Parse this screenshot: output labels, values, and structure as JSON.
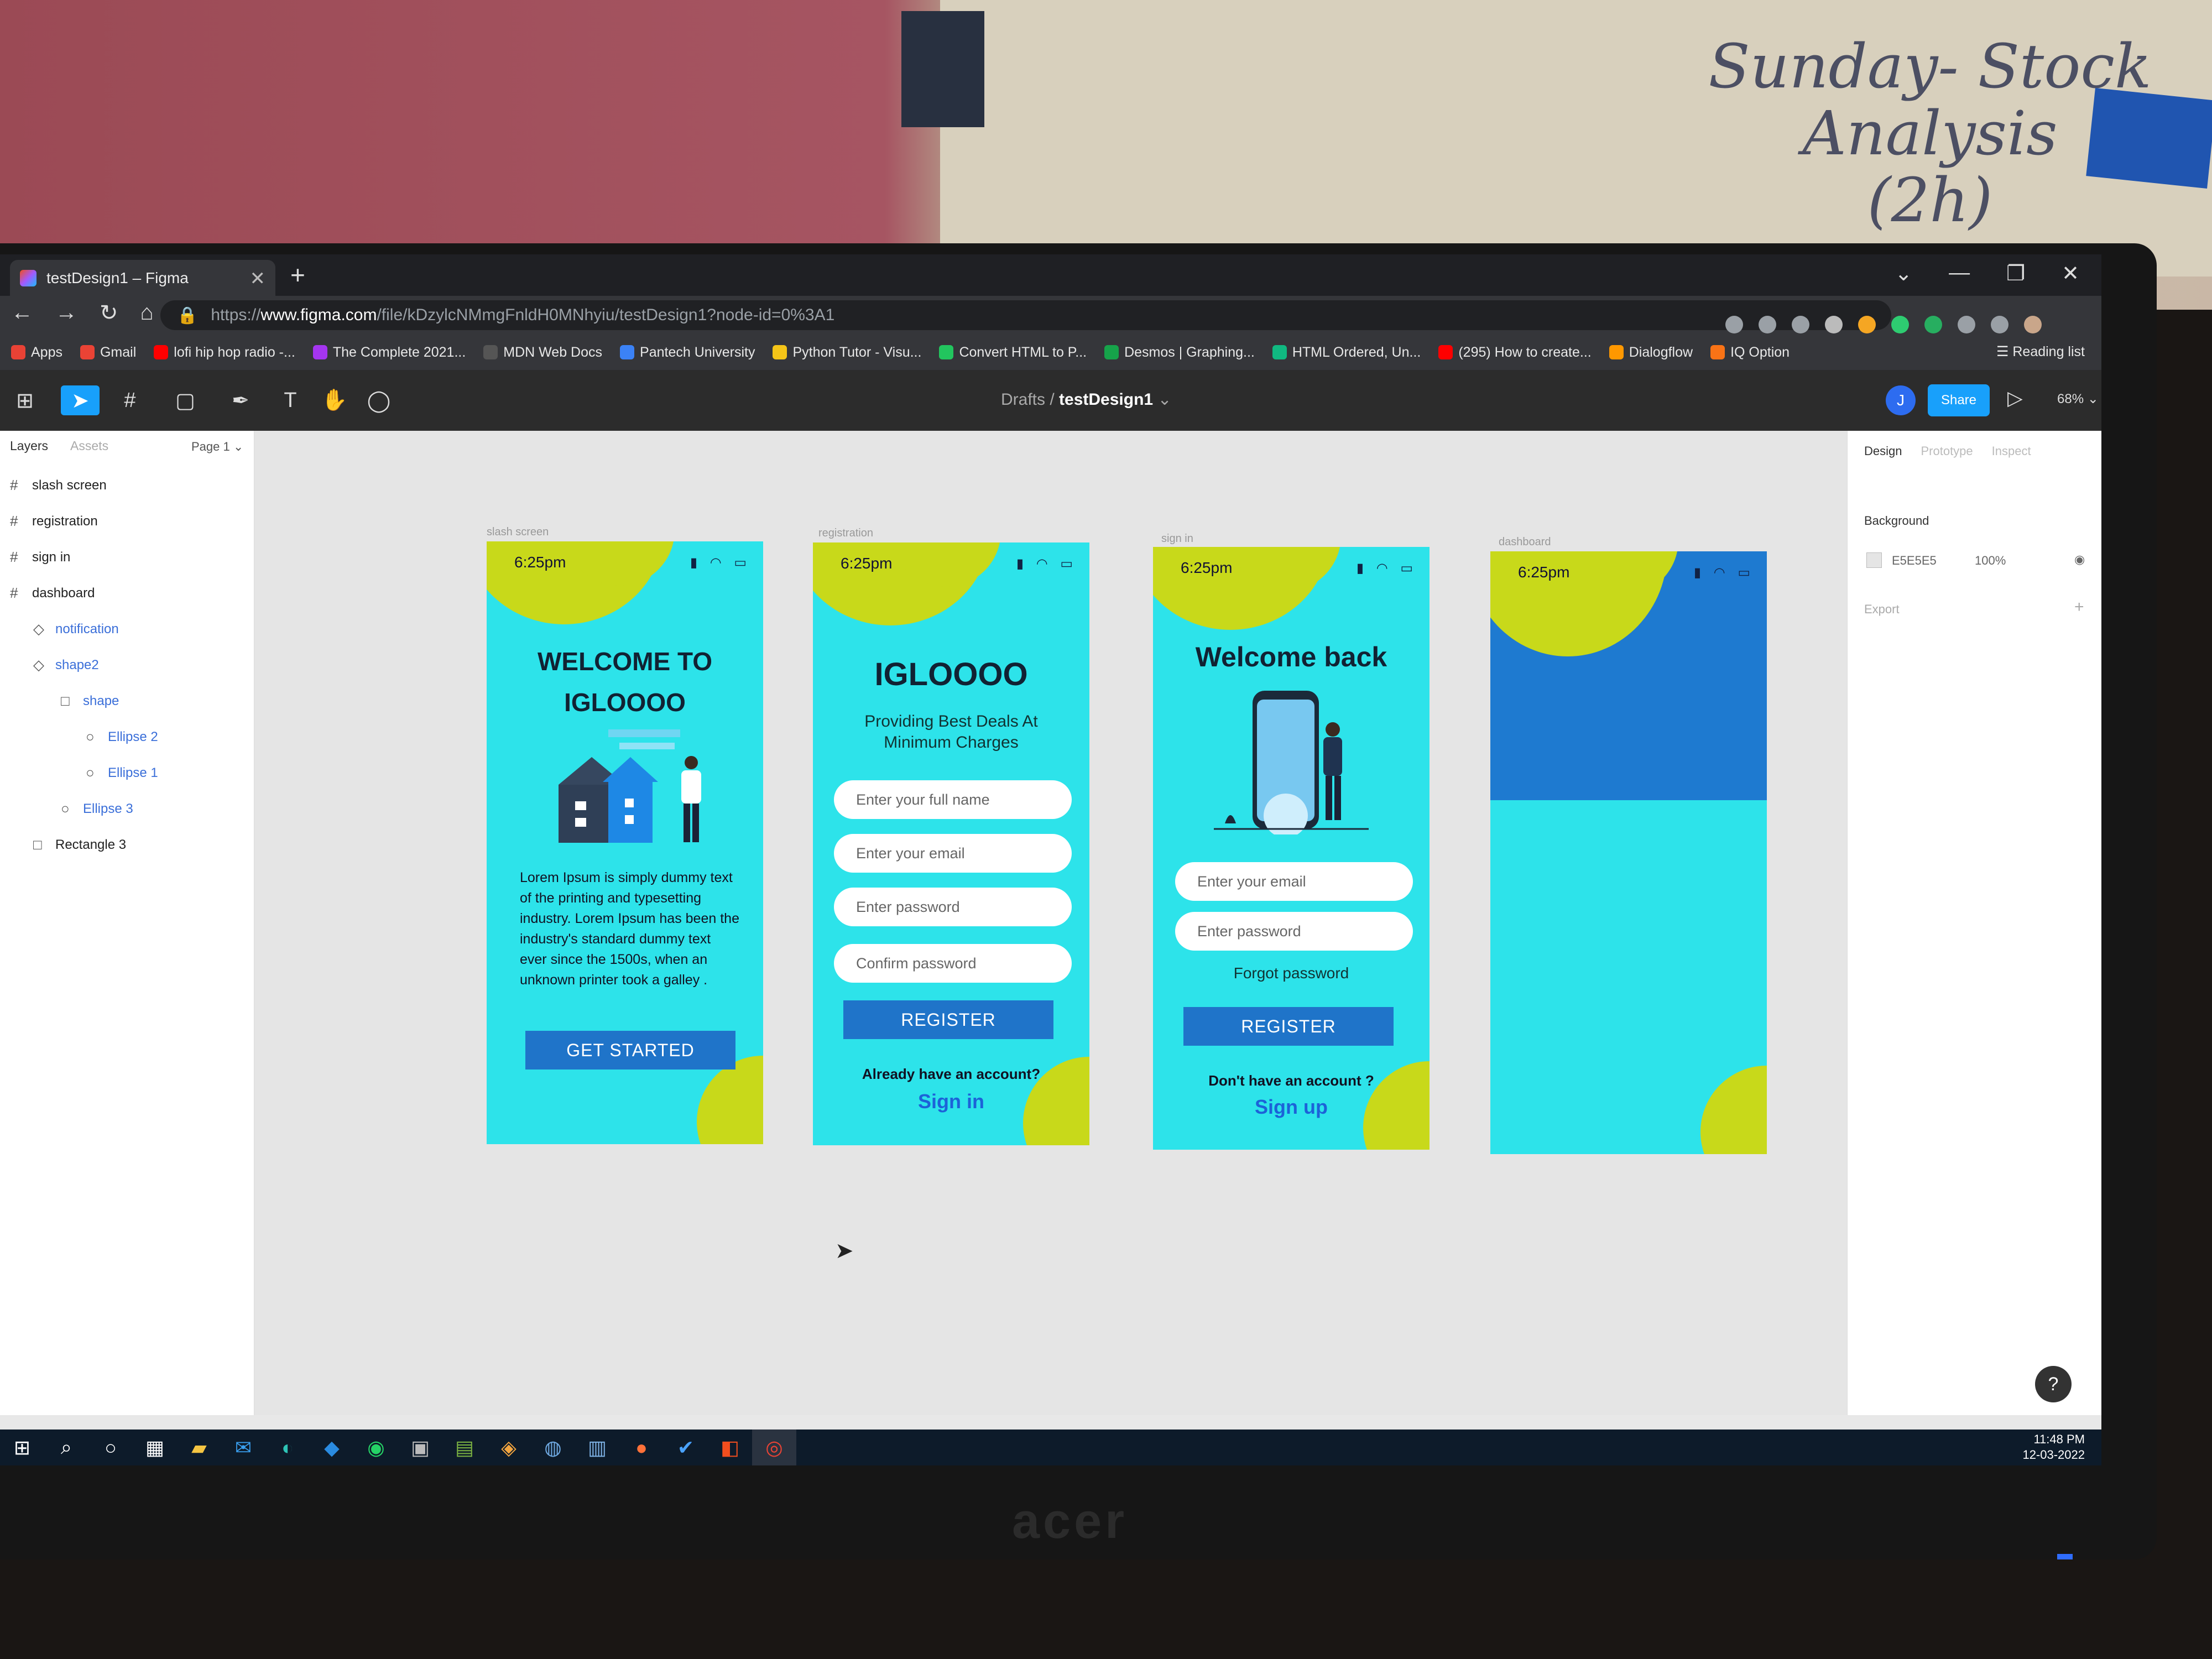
{
  "wall_note": {
    "line1": "Sunday- Stock Analysis",
    "line2": "(2h)"
  },
  "monitor_brand": "acer",
  "browser": {
    "tab_title": "testDesign1 – Figma",
    "url_prefix": "https://",
    "url_host": "www.figma.com",
    "url_path": "/file/kDzylcNMmgFnldH0MNhyiu/testDesign1?node-id=0%3A1",
    "bookmarks": [
      {
        "label": "Apps",
        "color": "#e94235"
      },
      {
        "label": "Gmail",
        "color": "#ea4335"
      },
      {
        "label": "lofi hip hop radio -...",
        "color": "#ff0000"
      },
      {
        "label": "The Complete 2021...",
        "color": "#a435f0"
      },
      {
        "label": "MDN Web Docs",
        "color": "#111111"
      },
      {
        "label": "Pantech University",
        "color": "#3b82f6"
      },
      {
        "label": "Python Tutor - Visu...",
        "color": "#f5c518"
      },
      {
        "label": "Convert HTML to P...",
        "color": "#22c55e"
      },
      {
        "label": "Desmos | Graphing...",
        "color": "#16a34a"
      },
      {
        "label": "HTML Ordered, Un...",
        "color": "#10b981"
      },
      {
        "label": "(295) How to create...",
        "color": "#ff0000"
      },
      {
        "label": "Dialogflow",
        "color": "#ff9800"
      },
      {
        "label": "IQ Option",
        "color": "#f97316"
      }
    ],
    "reading_list": "Reading list"
  },
  "figma": {
    "breadcrumb_folder": "Drafts",
    "breadcrumb_sep": "/",
    "file_name": "testDesign1",
    "avatar_initial": "J",
    "share_label": "Share",
    "zoom": "68%",
    "left_tabs": {
      "layers": "Layers",
      "assets": "Assets",
      "page": "Page 1"
    },
    "layers": [
      {
        "label": "slash screen",
        "icon": "#",
        "indent": 0,
        "child": false
      },
      {
        "label": "registration",
        "icon": "#",
        "indent": 0,
        "child": false
      },
      {
        "label": "sign in",
        "icon": "#",
        "indent": 0,
        "child": false
      },
      {
        "label": "dashboard",
        "icon": "#",
        "indent": 0,
        "child": false
      },
      {
        "label": "notification",
        "icon": "◇",
        "indent": 1,
        "child": true
      },
      {
        "label": "shape2",
        "icon": "◇",
        "indent": 1,
        "child": true
      },
      {
        "label": "shape",
        "icon": "□",
        "indent": 2,
        "child": true
      },
      {
        "label": "Ellipse 2",
        "icon": "○",
        "indent": 3,
        "child": true
      },
      {
        "label": "Ellipse 1",
        "icon": "○",
        "indent": 3,
        "child": true
      },
      {
        "label": "Ellipse 3",
        "icon": "○",
        "indent": 2,
        "child": true
      },
      {
        "label": "Rectangle 3",
        "icon": "□",
        "indent": 1,
        "child": false
      }
    ],
    "right_tabs": {
      "design": "Design",
      "prototype": "Prototype",
      "inspect": "Inspect"
    },
    "background_label": "Background",
    "background_hex": "E5E5E5",
    "background_opacity": "100%",
    "export_label": "Export",
    "help": "?"
  },
  "frames": {
    "splash": {
      "label": "slash screen",
      "time": "6:25pm",
      "title_line1": "WELCOME TO",
      "title_line2": "IGLOOOO",
      "body": "Lorem Ipsum is simply dummy text of the printing and typesetting industry. Lorem Ipsum has been the industry's standard dummy text ever since the 1500s, when an unknown printer took a galley .",
      "button": "GET STARTED"
    },
    "registration": {
      "label": "registration",
      "time": "6:25pm",
      "title": "IGLOOOO",
      "subtitle_line1": "Providing Best Deals At",
      "subtitle_line2": "Minimum Charges",
      "fields": [
        "Enter your full name",
        "Enter your email",
        "Enter password",
        "Confirm password"
      ],
      "button": "REGISTER",
      "prompt": "Already have an account?",
      "link": "Sign in"
    },
    "signin": {
      "label": "sign in",
      "time": "6:25pm",
      "title": "Welcome back",
      "fields": [
        "Enter your email",
        "Enter password"
      ],
      "forgot": "Forgot password",
      "button": "REGISTER",
      "prompt": "Don't have an account ?",
      "link": "Sign up"
    },
    "dashboard": {
      "label": "dashboard",
      "time": "6:25pm"
    }
  },
  "colors": {
    "frame_bg": "#2de3ea",
    "blob": "#c8d91a",
    "button": "#1f74c9",
    "dashboard_header": "#1e7ad0",
    "figma_blue": "#18a0fb"
  },
  "taskbar": {
    "time": "11:48 PM",
    "date": "12-03-2022"
  }
}
